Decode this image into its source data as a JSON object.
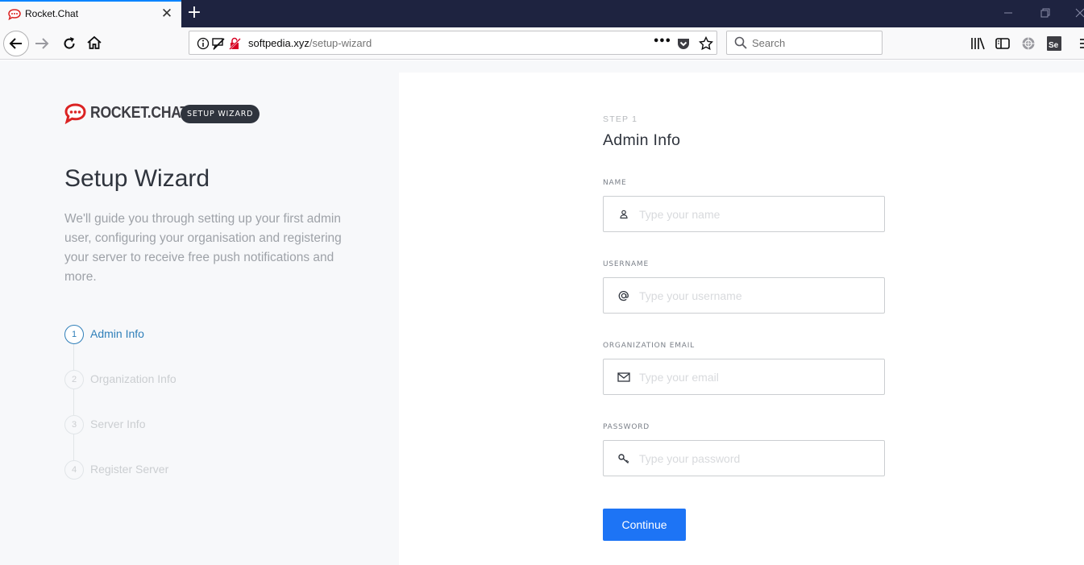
{
  "browser": {
    "tab_title": "Rocket.Chat",
    "url_domain": "softpedia.xyz",
    "url_path": "/setup-wizard",
    "search_placeholder": "Search",
    "toolbar_menu": "•••"
  },
  "sidebar": {
    "logo_text": "ROCKET.CHAT",
    "badge": "SETUP WIZARD",
    "title": "Setup Wizard",
    "description": "We'll guide you through setting up your first admin user, configuring your organisation and registering your server to receive free push notifications and more.",
    "steps": [
      {
        "num": "1",
        "label": "Admin Info",
        "active": true
      },
      {
        "num": "2",
        "label": "Organization Info",
        "active": false
      },
      {
        "num": "3",
        "label": "Server Info",
        "active": false
      },
      {
        "num": "4",
        "label": "Register Server",
        "active": false
      }
    ]
  },
  "form": {
    "step_kicker": "STEP 1",
    "title": "Admin Info",
    "fields": {
      "name": {
        "label": "NAME",
        "placeholder": "Type your name",
        "icon": "user-icon"
      },
      "username": {
        "label": "USERNAME",
        "placeholder": "Type your username",
        "icon": "at-icon"
      },
      "email": {
        "label": "ORGANIZATION EMAIL",
        "placeholder": "Type your email",
        "icon": "mail-icon"
      },
      "password": {
        "label": "PASSWORD",
        "placeholder": "Type your password",
        "icon": "key-icon"
      }
    },
    "continue_label": "Continue"
  },
  "colors": {
    "accent": "#1d74f5",
    "active_step": "#2f7fb9",
    "brand_red": "#db2323",
    "tabbar": "#1e2340"
  }
}
